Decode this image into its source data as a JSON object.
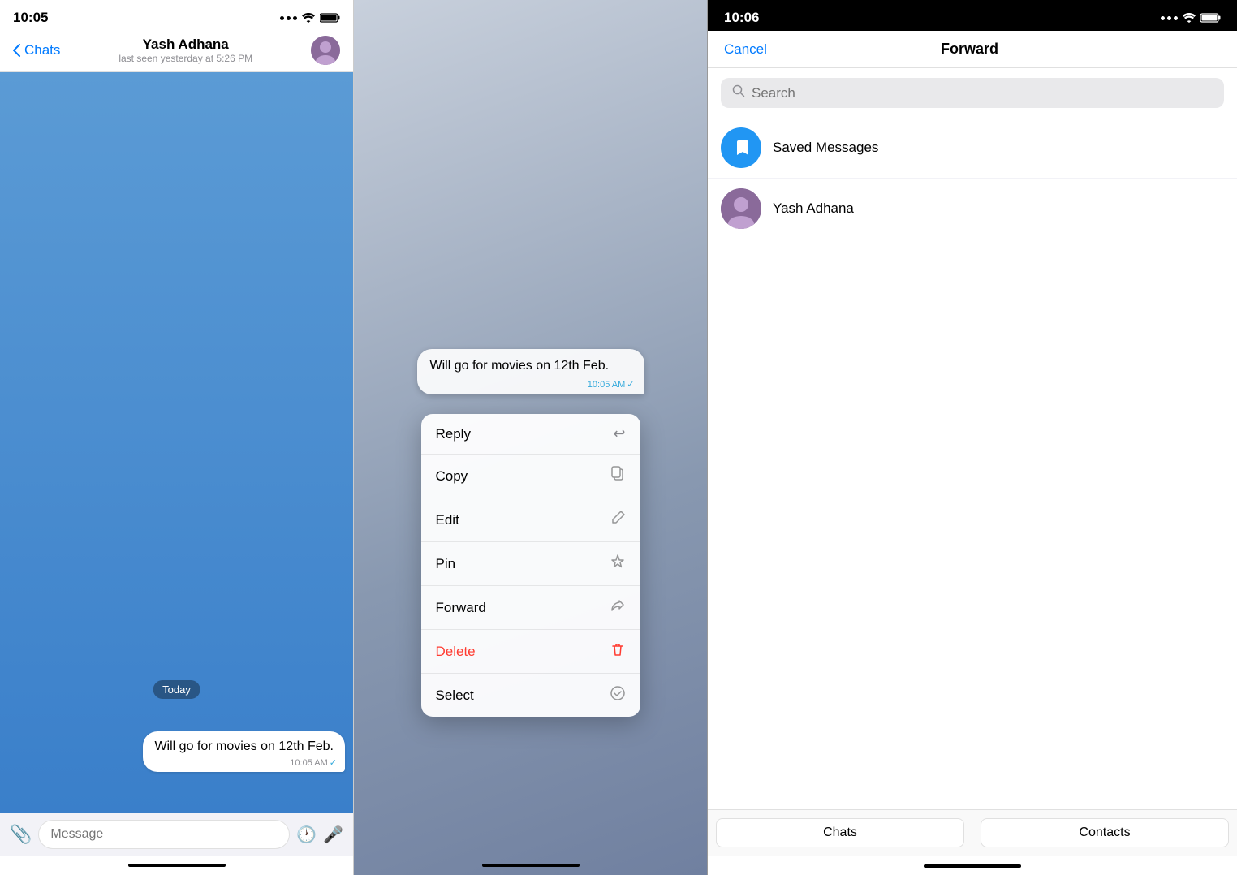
{
  "panel1": {
    "status": {
      "time": "10:05"
    },
    "nav": {
      "back_label": "Chats",
      "contact_name": "Yash Adhana",
      "last_seen": "last seen yesterday at 5:26 PM"
    },
    "date_badge": "Today",
    "message": "Will go for movies on 12th Feb.",
    "message_time": "10:05 AM",
    "input_placeholder": "Message"
  },
  "panel2": {
    "message": "Will go for movies on 12th Feb.",
    "message_time": "10:05 AM",
    "context_menu": {
      "items": [
        {
          "label": "Reply",
          "icon": "↩"
        },
        {
          "label": "Copy",
          "icon": "⧉"
        },
        {
          "label": "Edit",
          "icon": "✏"
        },
        {
          "label": "Pin",
          "icon": "📌"
        },
        {
          "label": "Forward",
          "icon": "↪"
        },
        {
          "label": "Delete",
          "icon": "🗑",
          "is_delete": true
        },
        {
          "label": "Select",
          "icon": "✓"
        }
      ]
    }
  },
  "panel3": {
    "status": {
      "time": "10:06"
    },
    "nav": {
      "cancel_label": "Cancel",
      "title": "Forward"
    },
    "search": {
      "placeholder": "Search"
    },
    "contacts": [
      {
        "name": "Saved Messages",
        "type": "saved"
      },
      {
        "name": "Yash Adhana",
        "type": "user"
      }
    ],
    "tabs": [
      {
        "label": "Chats"
      },
      {
        "label": "Contacts"
      }
    ]
  }
}
